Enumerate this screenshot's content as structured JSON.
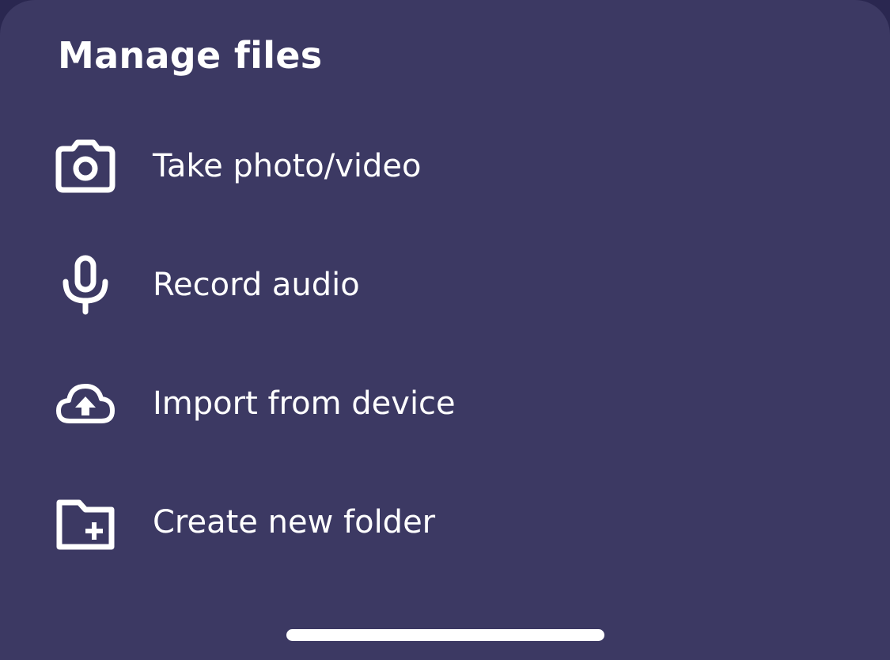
{
  "sheet": {
    "title": "Manage files"
  },
  "menu": {
    "items": [
      {
        "label": "Take photo/video",
        "icon": "camera-icon"
      },
      {
        "label": "Record audio",
        "icon": "microphone-icon"
      },
      {
        "label": "Import from device",
        "icon": "cloud-upload-icon"
      },
      {
        "label": "Create new folder",
        "icon": "folder-plus-icon"
      }
    ]
  },
  "colors": {
    "sheet_background": "#3c3963",
    "text": "#ffffff"
  }
}
